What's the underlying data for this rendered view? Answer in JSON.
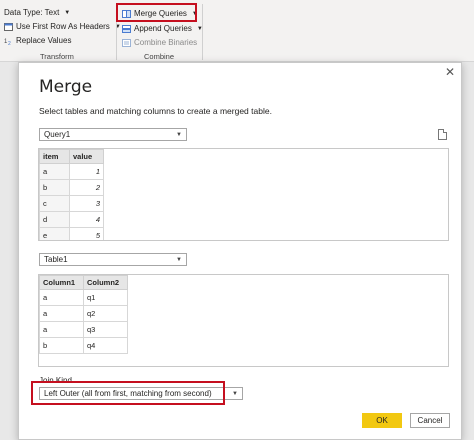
{
  "ribbon": {
    "data_type_label": "Data Type: Text",
    "use_first_row_label": "Use First Row As Headers",
    "replace_values_label": "Replace Values",
    "transform_group": "Transform",
    "merge_queries_label": "Merge Queries",
    "append_queries_label": "Append Queries",
    "combine_binaries_label": "Combine Binaries",
    "combine_group": "Combine"
  },
  "dialog": {
    "title": "Merge",
    "subtitle": "Select tables and matching columns to create a merged table.",
    "close_glyph": "✕",
    "query1": {
      "selected": "Query1",
      "headers": [
        "item",
        "value"
      ],
      "rows": [
        [
          "a",
          "1"
        ],
        [
          "b",
          "2"
        ],
        [
          "c",
          "3"
        ],
        [
          "d",
          "4"
        ],
        [
          "e",
          "5"
        ]
      ]
    },
    "table1": {
      "selected": "Table1",
      "headers": [
        "Column1",
        "Column2"
      ],
      "rows": [
        [
          "a",
          "q1"
        ],
        [
          "a",
          "q2"
        ],
        [
          "a",
          "q3"
        ],
        [
          "b",
          "q4"
        ]
      ]
    },
    "join_kind_label": "Join Kind",
    "join_kind_selected": "Left Outer (all from first, matching from second)",
    "ok_label": "OK",
    "cancel_label": "Cancel"
  },
  "colors": {
    "highlight": "#c50f1f",
    "ok_button": "#f2c811"
  },
  "icons": [
    "data-type-icon",
    "headers-icon",
    "replace-icon",
    "merge-icon",
    "append-icon",
    "combine-icon",
    "document-icon",
    "close-icon"
  ]
}
